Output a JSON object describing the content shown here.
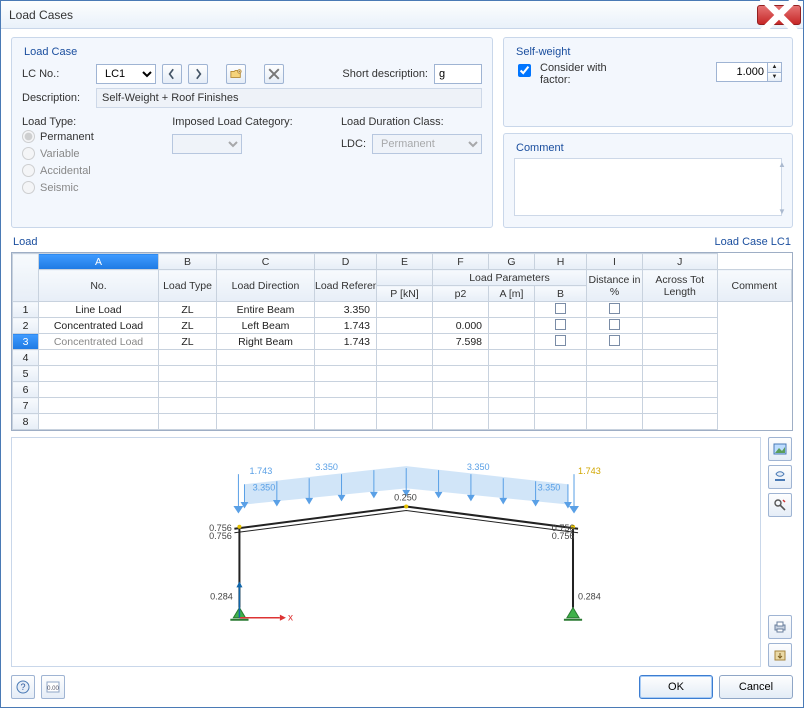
{
  "window": {
    "title": "Load Cases"
  },
  "loadcase": {
    "legend": "Load Case",
    "lc_no_label": "LC No.:",
    "lc_no_value": "LC1",
    "short_desc_label": "Short description:",
    "short_desc_value": "g",
    "description_label": "Description:",
    "description_value": "Self-Weight + Roof Finishes",
    "load_type_label": "Load Type:",
    "radios": {
      "permanent": "Permanent",
      "variable": "Variable",
      "accidental": "Accidental",
      "seismic": "Seismic"
    },
    "ilc_label": "Imposed Load Category:",
    "ldc_group_label": "Load Duration Class:",
    "ldc_label": "LDC:",
    "ldc_value": "Permanent"
  },
  "selfweight": {
    "legend": "Self-weight",
    "consider_label": "Consider with factor:",
    "factor_value": "1.000"
  },
  "comment": {
    "legend": "Comment",
    "value": ""
  },
  "load": {
    "header_left": "Load",
    "header_right": "Load Case LC1",
    "cols": {
      "no": "No.",
      "A": "A",
      "B": "B",
      "C": "C",
      "D": "D",
      "E": "E",
      "F": "F",
      "G": "G",
      "H": "H",
      "I": "I",
      "J": "J",
      "load_type": "Load Type",
      "load_direction": "Load Direction",
      "load_reference": "Load Reference",
      "p": "P [kN]",
      "load_parameters": "Load Parameters",
      "p2": "p2",
      "am": "A [m]",
      "bcol": "B",
      "distance": "Distance in %",
      "across": "Across Tot Length",
      "comment": "Comment"
    },
    "rows": [
      {
        "n": "1",
        "type": "Line Load",
        "dir": "ZL",
        "ref": "Entire Beam",
        "p": "3.350",
        "p2": "",
        "a": "",
        "b": "",
        "dist": false,
        "across": false,
        "selected": false
      },
      {
        "n": "2",
        "type": "Concentrated Load",
        "dir": "ZL",
        "ref": "Left Beam",
        "p": "1.743",
        "p2": "",
        "a": "0.000",
        "b": "",
        "dist": false,
        "across": false,
        "selected": false
      },
      {
        "n": "3",
        "type": "Concentrated Load",
        "dir": "ZL",
        "ref": "Right Beam",
        "p": "1.743",
        "p2": "",
        "a": "7.598",
        "b": "",
        "dist": false,
        "across": false,
        "selected": true
      }
    ],
    "empty_rows": [
      "4",
      "5",
      "6",
      "7",
      "8"
    ]
  },
  "preview": {
    "line_load_value": "3.350",
    "conc_left": "1.743",
    "conc_right": "1.743",
    "node_vals": {
      "apex": "0.250",
      "eaveL": "0.756",
      "eaveR": "0.756",
      "baseL": "0.284",
      "baseR": "0.284"
    },
    "axis_x": "x"
  },
  "footer": {
    "ok": "OK",
    "cancel": "Cancel"
  }
}
